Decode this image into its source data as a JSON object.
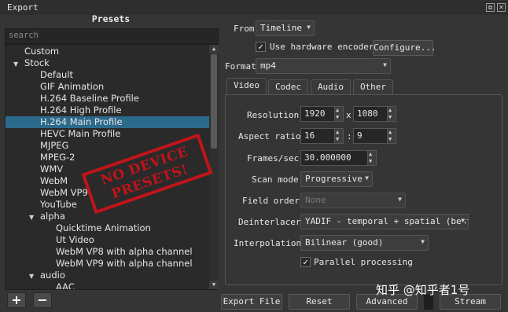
{
  "window": {
    "title": "Export"
  },
  "presets": {
    "heading": "Presets",
    "search_placeholder": "search",
    "items": [
      {
        "label": "Custom",
        "level": 1,
        "arrow": ""
      },
      {
        "label": "Stock",
        "level": 1,
        "arrow": "▼"
      },
      {
        "label": "Default",
        "level": 2,
        "arrow": ""
      },
      {
        "label": "GIF Animation",
        "level": 2,
        "arrow": ""
      },
      {
        "label": "H.264 Baseline Profile",
        "level": 2,
        "arrow": ""
      },
      {
        "label": "H.264 High Profile",
        "level": 2,
        "arrow": ""
      },
      {
        "label": "H.264 Main Profile",
        "level": 2,
        "arrow": "",
        "selected": true
      },
      {
        "label": "HEVC Main Profile",
        "level": 2,
        "arrow": ""
      },
      {
        "label": "MJPEG",
        "level": 2,
        "arrow": ""
      },
      {
        "label": "MPEG-2",
        "level": 2,
        "arrow": ""
      },
      {
        "label": "WMV",
        "level": 2,
        "arrow": ""
      },
      {
        "label": "WebM",
        "level": 2,
        "arrow": ""
      },
      {
        "label": "WebM VP9",
        "level": 2,
        "arrow": ""
      },
      {
        "label": "YouTube",
        "level": 2,
        "arrow": ""
      },
      {
        "label": "alpha",
        "level": 2,
        "arrow": "▼"
      },
      {
        "label": "Quicktime Animation",
        "level": 3,
        "arrow": ""
      },
      {
        "label": "Ut Video",
        "level": 3,
        "arrow": ""
      },
      {
        "label": "WebM VP8 with alpha channel",
        "level": 3,
        "arrow": ""
      },
      {
        "label": "WebM VP9 with alpha channel",
        "level": 3,
        "arrow": ""
      },
      {
        "label": "audio",
        "level": 2,
        "arrow": "▼"
      },
      {
        "label": "AAC",
        "level": 3,
        "arrow": ""
      }
    ],
    "stamp_text": [
      "NO DEVICE",
      "PRESETS!"
    ],
    "add_label": "+",
    "remove_label": "−"
  },
  "from": {
    "label": "From",
    "value": "Timeline"
  },
  "hardware_encoder": {
    "label": "Use hardware encoder",
    "checked": true,
    "check_glyph": "✓"
  },
  "configure_label": "Configure...",
  "format": {
    "label": "Format",
    "value": "mp4"
  },
  "tabs": [
    {
      "label": "Video",
      "active": true
    },
    {
      "label": "Codec",
      "active": false
    },
    {
      "label": "Audio",
      "active": false
    },
    {
      "label": "Other",
      "active": false
    }
  ],
  "video": {
    "resolution_label": "Resolution",
    "width": "1920",
    "x_sep": "x",
    "height": "1080",
    "aspect_label": "Aspect ratio",
    "aspect_w": "16",
    "aspect_sep": ":",
    "aspect_h": "9",
    "fps_label": "Frames/sec",
    "fps": "30.000000",
    "scan_label": "Scan mode",
    "scan": "Progressive",
    "field_label": "Field order",
    "field": "None",
    "deint_label": "Deinterlacer",
    "deint": "YADIF - temporal + spatial (best",
    "interp_label": "Interpolation",
    "interp": "Bilinear (good)",
    "parallel_label": "Parallel processing",
    "parallel_checked": true
  },
  "bottom": {
    "export_label": "Export File",
    "reset_label": "Reset",
    "advanced_label": "Advanced",
    "stream_label": "Stream"
  },
  "watermark": "知乎 @知乎者1号",
  "colors": {
    "selection": "#2c6a8c",
    "stamp": "#c0141b",
    "background": "#353535"
  }
}
